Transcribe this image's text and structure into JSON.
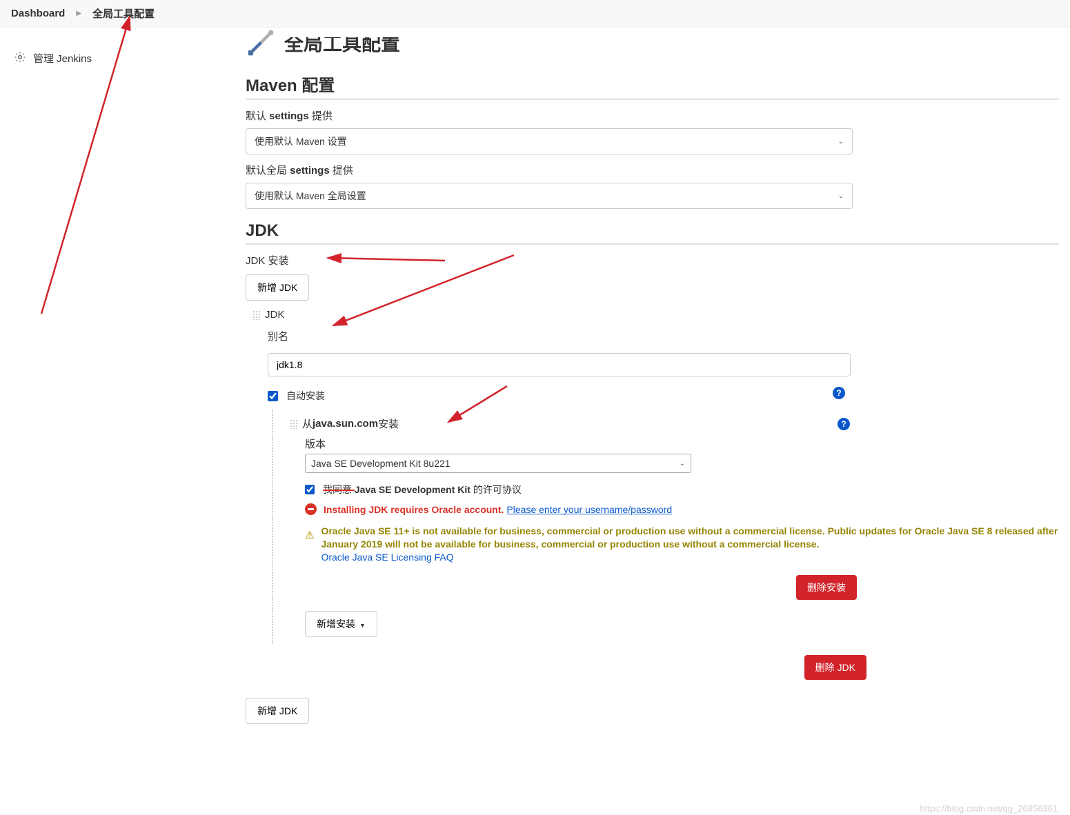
{
  "breadcrumb": {
    "root": "Dashboard",
    "current": "全局工具配置"
  },
  "sidebar": {
    "manage_label": "管理 Jenkins"
  },
  "header": {
    "title": "全局工具配置"
  },
  "maven": {
    "section_title": "Maven 配置",
    "default_settings_label_pre": "默认 ",
    "default_settings_label_bold": "settings",
    "default_settings_label_post": " 提供",
    "default_settings_value": "使用默认 Maven 设置",
    "global_settings_label_pre": "默认全局 ",
    "global_settings_label_bold": "settings",
    "global_settings_label_post": " 提供",
    "global_settings_value": "使用默认 Maven 全局设置"
  },
  "jdk": {
    "section_title": "JDK",
    "install_label": "JDK 安装",
    "add_btn": "新增 JDK",
    "block_title": "JDK",
    "alias_label": "别名",
    "alias_value": "jdk1.8",
    "auto_install_label": "自动安装",
    "auto_install_checked": true,
    "installer": {
      "title_pre": "从 ",
      "title_bold": "java.sun.com",
      "title_post": "安装",
      "version_label": "版本",
      "version_value": "Java SE Development Kit 8u221",
      "license_checked": true,
      "license_text_a": "我同意 ",
      "license_text_bold": "Java SE Development Kit",
      "license_text_b": " 的许可协议",
      "error_text": "Installing JDK requires Oracle account.",
      "error_link": "Please enter your username/password",
      "warn_line1": "Oracle Java SE 11+ is not available for business, commercial or production use without a commercial license.",
      "warn_line2": "Public updates for Oracle Java SE 8 released after January 2019 will not be available for business, commercial or production use without a commercial license.",
      "faq_link": "Oracle Java SE Licensing FAQ",
      "delete_install_btn": "删除安装"
    },
    "add_installer_btn": "新增安装",
    "delete_jdk_btn": "删除 JDK",
    "add_btn2": "新增 JDK"
  },
  "watermark": "https://blog.csdn.net/qg_26856361"
}
